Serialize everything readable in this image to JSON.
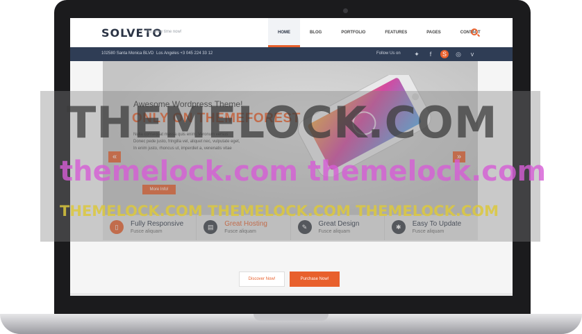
{
  "site": {
    "logo": "SOLVETO",
    "tagline": "It's show time now!",
    "menu": [
      "HOME",
      "BLOG",
      "PORTFOLIO",
      "FEATURES",
      "PAGES",
      "CONTACT"
    ],
    "active_menu": "HOME"
  },
  "infobar": {
    "address": "102580 Santa Monica BLVD",
    "phone": "Los Angeles +3 045 224 33 12",
    "follow_label": "Follow Us on",
    "social_icons": [
      "twitter-icon",
      "facebook-icon",
      "skype-icon",
      "dribbble-icon",
      "vimeo-icon"
    ]
  },
  "hero": {
    "kicker": "Awesome Wordpress Theme!",
    "headline": "ONLY ON THEMEFOREST",
    "lorem": [
      "Nulla consequat massa quis enim. Veronum versus",
      "Donec pede justo, fringilla vel, aliquet nec, vulputate eget,",
      "In enim justo, rhoncus ut, imperdiet a, venenatis vitae"
    ],
    "button": "More Info!",
    "prev_arrow": "«",
    "next_arrow": "»"
  },
  "features": [
    {
      "title": "Fully Responsive",
      "sub": "Fusce  aliquam",
      "icon": "mobile-icon",
      "color": "#e8602c"
    },
    {
      "title": "Great Hosting",
      "sub": "Fusce  aliquam",
      "icon": "hosting-icon",
      "color": "#3b3f47"
    },
    {
      "title": "Great Design",
      "sub": "Fusce  aliquam",
      "icon": "design-icon",
      "color": "#3b3f47"
    },
    {
      "title": "Easy To Update",
      "sub": "Fusce  aliquam",
      "icon": "update-icon",
      "color": "#3b3f47"
    }
  ],
  "cta": {
    "discover": "Discover Now!",
    "purchase": "Purchase Now!"
  },
  "watermark": {
    "line1": "THEMELOCK.COM",
    "line2": "themelock.com themelock.com",
    "line3": "THEMELOCK.COM THEMELOCK.COM THEMELOCK.COM"
  },
  "colors": {
    "accent": "#e8602c",
    "navy": "#2f3d55"
  }
}
